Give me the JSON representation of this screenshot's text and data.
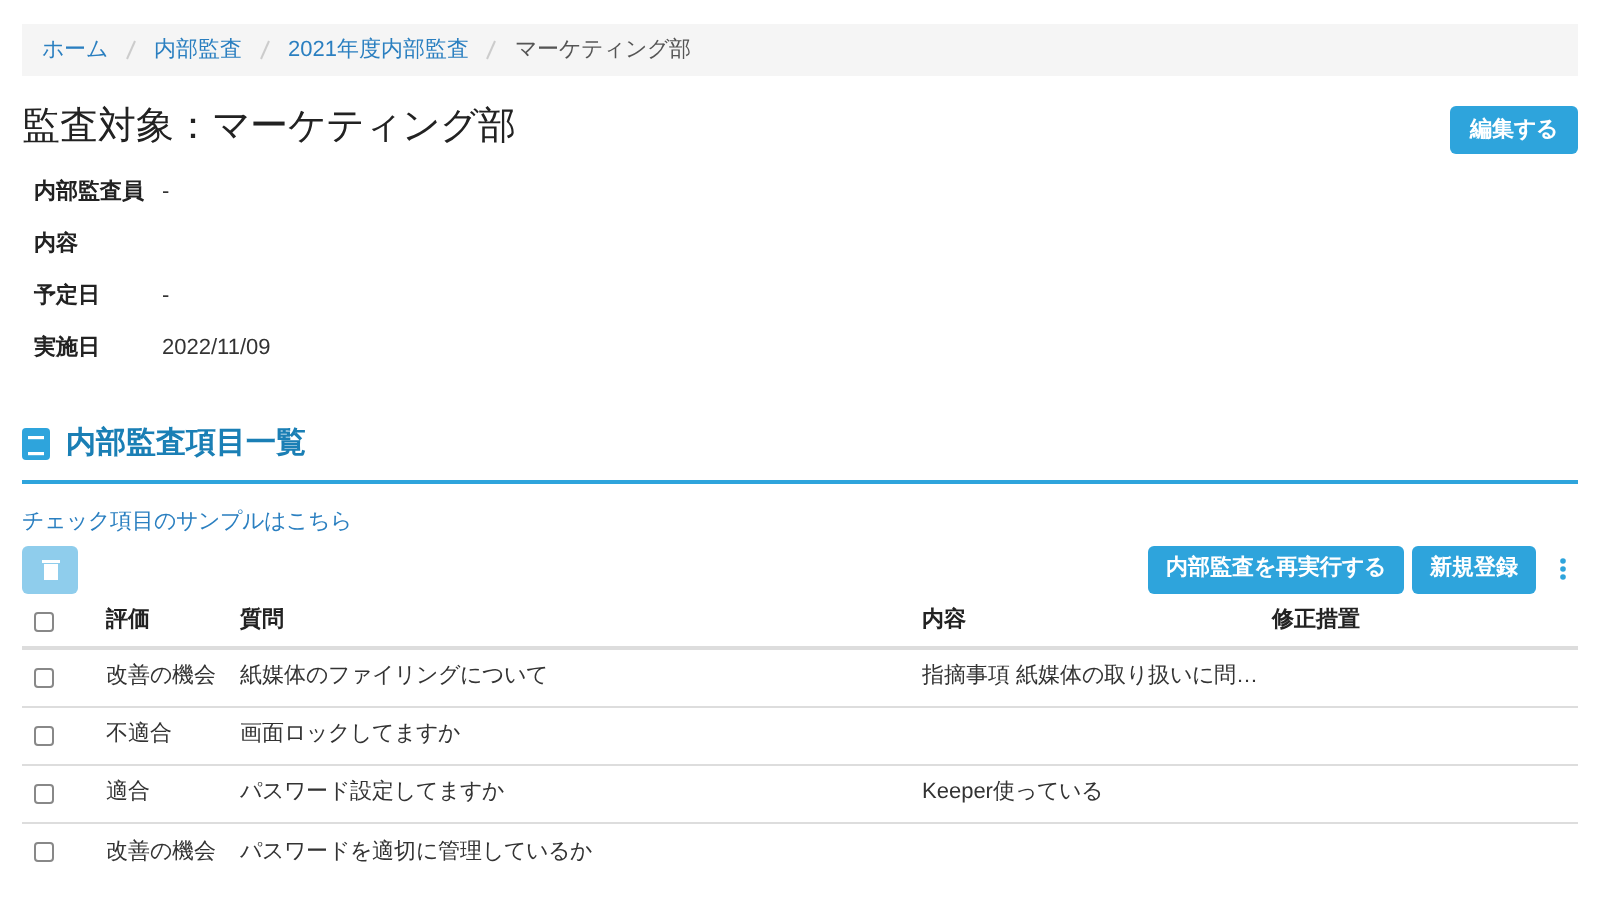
{
  "breadcrumb": [
    {
      "label": "ホーム",
      "link": true
    },
    {
      "label": "内部監査",
      "link": true
    },
    {
      "label": "2021年度内部監査",
      "link": true
    },
    {
      "label": "マーケティング部",
      "link": false
    }
  ],
  "title": "監査対象：マーケティング部",
  "edit_button": "編集する",
  "details": [
    {
      "label": "内部監査員",
      "value": "-"
    },
    {
      "label": "内容"
    },
    {
      "label": "予定日",
      "value": "-"
    },
    {
      "label": "実施日",
      "value": "2022/11/09"
    }
  ],
  "section_title": "内部監査項目一覧",
  "sample_link": "チェック項目のサンプルはこちら",
  "delete_button": {
    "disabled": true
  },
  "action_buttons": [
    "内部監査を再実行する",
    "新規登録"
  ],
  "table": {
    "header_checked": false,
    "columns": [
      "評価",
      "質問",
      "内容",
      "修正措置"
    ],
    "rows": [
      {
        "checked": false,
        "cells": [
          "改善の機会",
          "紙媒体のファイリングについて",
          "指摘事項 紙媒体の取り扱いに問…",
          null
        ]
      },
      {
        "checked": false,
        "cells": [
          "不適合",
          "画面ロックしてますか",
          null,
          null
        ]
      },
      {
        "checked": false,
        "cells": [
          "適合",
          "パスワード設定してますか",
          "Keeper使っている",
          null
        ]
      },
      {
        "checked": false,
        "cells": [
          "改善の機会",
          "パスワードを適切に管理しているか",
          null,
          null
        ]
      }
    ]
  }
}
